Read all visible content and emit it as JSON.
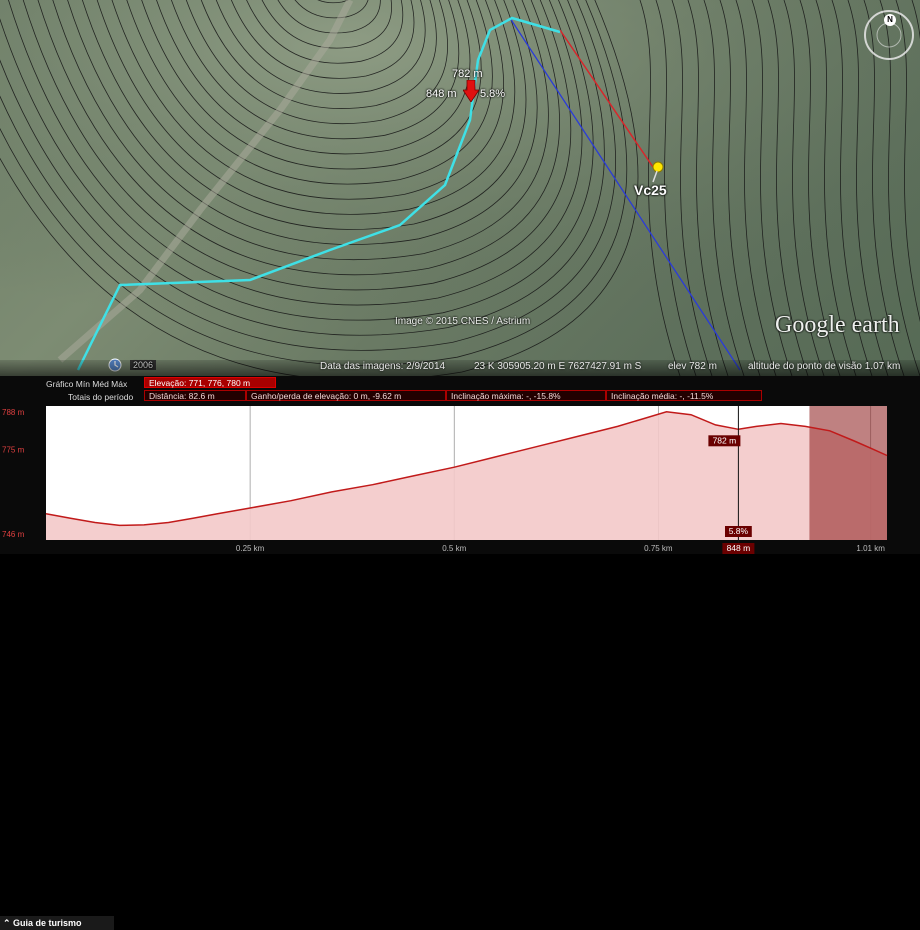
{
  "map": {
    "marker_elevation": "782 m",
    "marker_distance": "848 m",
    "marker_slope": "5.8%",
    "placemark_label": "Vc25",
    "imagery_credit": "Image © 2015 CNES / Astrium",
    "brand": "Google earth",
    "compass_north": "N",
    "historical_year": "2006"
  },
  "status_bar": {
    "imagery_date": "Data das imagens: 2/9/2014",
    "coordinates": "23 K 305905.20 m E 7627427.91 m S",
    "elevation": "elev  782 m",
    "eye_altitude": "altitude do ponto de visão  1.07 km"
  },
  "profile": {
    "graph_label": "Gráfico  Mín  Méd  Máx",
    "elevation_stats": "Elevação: 771, 776, 780 m",
    "totals_label": "Totais do período",
    "distance": "Distância: 82.6 m",
    "gain_loss": "Ganho/perda de elevação: 0 m, -9.62 m",
    "max_slope": "Inclinação máxima:  -, -15.8%",
    "avg_slope": "Inclinação média:  -, -11.5%",
    "y_ticks": [
      "788 m",
      "775 m",
      "746 m"
    ],
    "x_ticks": [
      "0.25 km",
      "0.5 km",
      "0.75 km",
      "1.01 km"
    ],
    "cursor_elev": "782 m",
    "cursor_slope": "5.8%",
    "cursor_dist": "848 m",
    "guide_label": "Guia de turismo"
  },
  "chart_data": {
    "type": "area",
    "xlabel": "",
    "ylabel": "",
    "x_unit": "km",
    "y_unit": "m",
    "xlim": [
      0,
      1.03
    ],
    "ylim": [
      744,
      790
    ],
    "selection_start_km": 0.935,
    "cursor_km": 0.848,
    "x": [
      0,
      0.03,
      0.06,
      0.09,
      0.12,
      0.15,
      0.18,
      0.21,
      0.25,
      0.3,
      0.35,
      0.4,
      0.45,
      0.5,
      0.55,
      0.6,
      0.65,
      0.7,
      0.73,
      0.76,
      0.79,
      0.82,
      0.848,
      0.87,
      0.9,
      0.93,
      0.96,
      0.99,
      1.01,
      1.03
    ],
    "values": [
      753,
      751.5,
      750,
      749,
      749.2,
      750,
      751.5,
      753,
      755,
      757.5,
      760.5,
      763,
      766,
      769,
      772.5,
      776,
      779.5,
      783,
      785.5,
      788,
      787,
      783.5,
      782,
      783,
      784,
      783,
      781.5,
      778,
      775.5,
      773
    ]
  },
  "colors": {
    "track": "#3fe0e6",
    "profile_line": "#c11a1a",
    "profile_fill": "#f3c9c9",
    "highlight": "#a80000"
  }
}
